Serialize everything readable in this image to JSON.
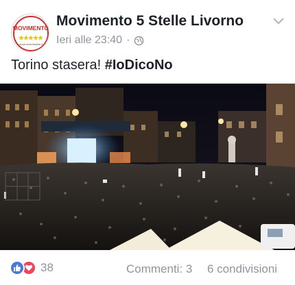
{
  "post": {
    "page_name": "Movimento 5 Stelle Livorno",
    "timestamp": "Ieri alle 23:40",
    "separator": "·",
    "audience_icon": "globe-icon",
    "text_prefix": "Torino stasera! ",
    "hashtag": "#IoDicoNo",
    "menu_icon": "chevron-down-icon"
  },
  "avatar": {
    "logo_word": "MOVIMENTO",
    "logo_text": "movimento5stelle.it"
  },
  "reactions": {
    "icons": [
      "like-icon",
      "love-icon"
    ],
    "count": "38"
  },
  "stats": {
    "comments": "Commenti: 3",
    "shares": "6 condivisioni"
  },
  "colors": {
    "text": "#1d2129",
    "meta": "#90949c",
    "like": "#4a78d6",
    "love": "#f0445f"
  }
}
